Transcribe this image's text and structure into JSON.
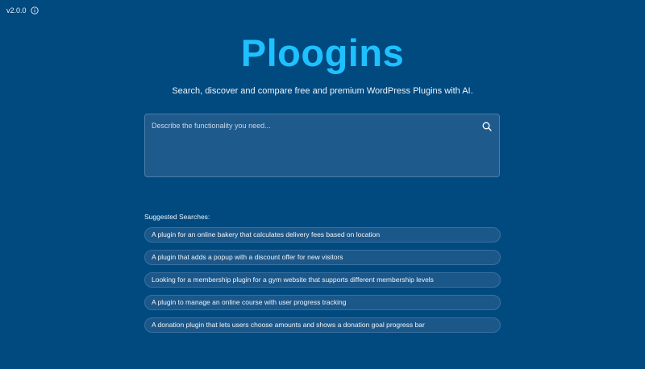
{
  "version": {
    "label": "v2.0.0",
    "icon": "info-icon"
  },
  "header": {
    "title": "Ploogins",
    "subtitle": "Search, discover and compare free and premium WordPress Plugins with AI."
  },
  "search": {
    "placeholder": "Describe the functionality you need...",
    "value": "",
    "icon": "search-icon"
  },
  "suggested": {
    "label": "Suggested Searches:",
    "items": [
      "A plugin for an online bakery that calculates delivery fees based on location",
      "A plugin that adds a popup with a discount offer for new visitors",
      "Looking for a membership plugin for a gym website that supports different membership levels",
      "A plugin to manage an online course with user progress tracking",
      "A donation plugin that lets users choose amounts and shows a donation goal progress bar"
    ]
  },
  "colors": {
    "background": "#004a80",
    "accent": "#1ec1ff",
    "search_bg": "#1f5a8d",
    "pill_bg": "#1c5789"
  }
}
